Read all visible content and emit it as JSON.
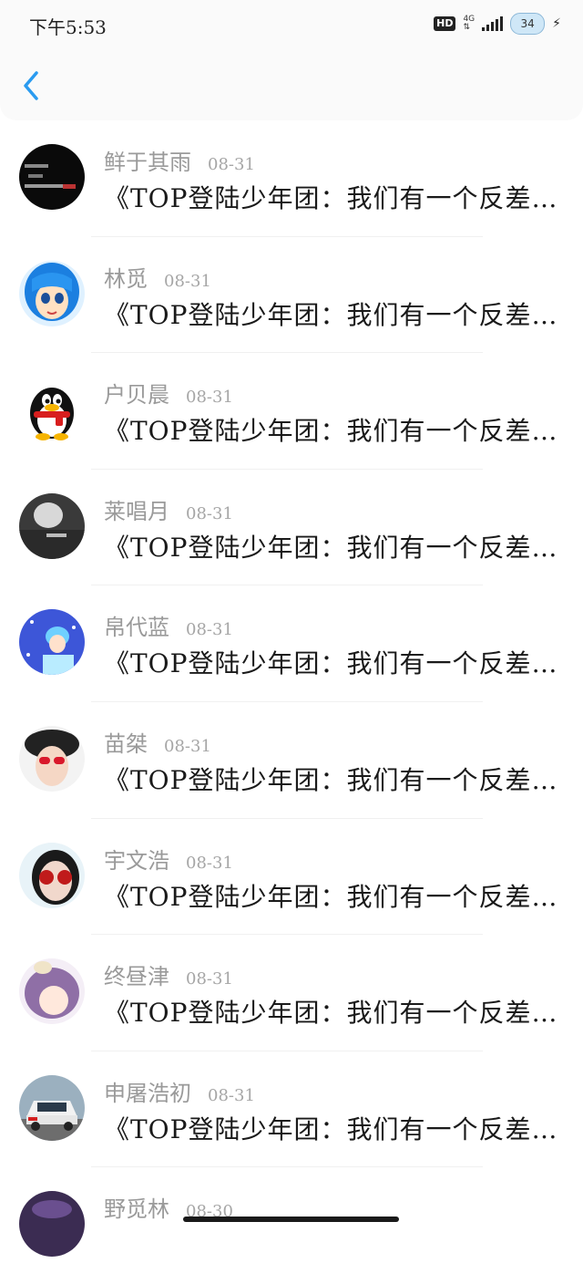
{
  "status_bar": {
    "time": "下午5:53",
    "hd": "HD",
    "network": "4G",
    "battery": "34"
  },
  "header": {
    "back_icon": "chevron-left-icon",
    "accent_color": "#2a9bf0"
  },
  "items": [
    {
      "name": "鲜于其雨",
      "date": "08-31",
      "message": "《TOP登陆少年团：我们有一个反差萌大男孩》",
      "avatar": "dark-text-avatar"
    },
    {
      "name": "林觅",
      "date": "08-31",
      "message": "《TOP登陆少年团：我们有一个反差萌大男孩》",
      "avatar": "blue-anime-girl-avatar"
    },
    {
      "name": "户贝晨",
      "date": "08-31",
      "message": "《TOP登陆少年团：我们有一个反差萌大男孩》",
      "avatar": "penguin-avatar"
    },
    {
      "name": "莱唱月",
      "date": "08-31",
      "message": "《TOP登陆少年团：我们有一个反差萌大男孩》",
      "avatar": "grey-photo-avatar"
    },
    {
      "name": "帛代蓝",
      "date": "08-31",
      "message": "《TOP登陆少年团：我们有一个反差萌大男孩》",
      "avatar": "winter-girl-avatar"
    },
    {
      "name": "苗桀",
      "date": "08-31",
      "message": "《TOP登陆少年团：我们有一个反差萌大男孩》",
      "avatar": "fur-hat-avatar"
    },
    {
      "name": "宇文浩",
      "date": "08-31",
      "message": "《TOP登陆少年团：我们有一个反差萌大男孩》",
      "avatar": "sunglasses-avatar"
    },
    {
      "name": "终昼津",
      "date": "08-31",
      "message": "《TOP登陆少年团：我们有一个反差萌大男孩》",
      "avatar": "purple-hair-avatar"
    },
    {
      "name": "申屠浩初",
      "date": "08-31",
      "message": "《TOP登陆少年团：我们有一个反差萌大男孩》",
      "avatar": "rally-car-avatar"
    },
    {
      "name": "野觅林",
      "date": "08-30",
      "message": "",
      "avatar": "purple-photo-avatar"
    }
  ]
}
